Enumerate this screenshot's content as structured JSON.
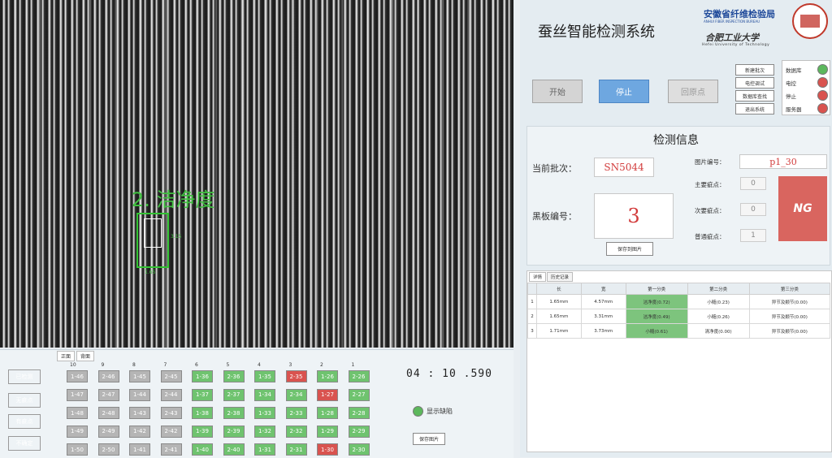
{
  "app": {
    "title": "蚕丝智能检测系统",
    "org1": "安徽省纤维检验局",
    "org1_sub": "ANHUI FIBER INSPECTION BUREAU",
    "org2": "合肥工业大学",
    "org2_sub": "Hefei University of Technology"
  },
  "camera": {
    "overlay_label": "2. 洁净度",
    "tag_right": "3.15",
    "tag_bottom": "1.65"
  },
  "controls": {
    "start": "开始",
    "stop": "停止",
    "home": "回原点",
    "small_buttons": [
      "新建批次",
      "电控调试",
      "数据库查找",
      "退出系统"
    ]
  },
  "status": [
    {
      "label": "数据库",
      "color": "#5cb85c"
    },
    {
      "label": "电控",
      "color": "#d9534f"
    },
    {
      "label": "停止",
      "color": "#d9534f"
    },
    {
      "label": "服务器",
      "color": "#d9534f"
    }
  ],
  "info": {
    "title": "检测信息",
    "batch_label": "当前批次：",
    "batch_value": "SN5044",
    "board_label": "黑板编号：",
    "board_value": "3",
    "pic_label": "图片编号：",
    "pic_value": "p1_30",
    "major_label": "主要疵点：",
    "major_value": "0",
    "minor_label": "次要疵点：",
    "minor_value": "0",
    "general_label": "普通疵点：",
    "general_value": "1",
    "result": "NG",
    "switch_btn": "保存到图片"
  },
  "results_table": {
    "tabs": [
      "详情",
      "历史记录"
    ],
    "headers": [
      "",
      "长",
      "宽",
      "第一分类",
      "第二分类",
      "第三分类"
    ],
    "rows": [
      [
        "1",
        "1.65mm",
        "4.57mm",
        "洁净度(0.72)",
        "小糙(0.23)",
        "异节及颣节(0.00)"
      ],
      [
        "2",
        "1.65mm",
        "3.31mm",
        "洁净度(0.49)",
        "小糙(0.26)",
        "异节及颣节(0.00)"
      ],
      [
        "3",
        "1.71mm",
        "3.73mm",
        "小糙(0.61)",
        "清净度(0.00)",
        "异节及颣节(0.00)"
      ]
    ]
  },
  "legend": [
    {
      "label": "已检测",
      "color": "#b5b5b5"
    },
    {
      "label": "无疵点",
      "color": "#6fc36f"
    },
    {
      "label": "有疵点",
      "color": "#d9534f"
    },
    {
      "label": "不确定",
      "color": "#4a90d9"
    }
  ],
  "grid": {
    "tabs": [
      "正面",
      "背面"
    ],
    "columns": [
      "10",
      "9",
      "8",
      "7",
      "6",
      "5",
      "4",
      "3",
      "2",
      "1"
    ],
    "rows": [
      [
        {
          "t": "1-46",
          "s": "gray"
        },
        {
          "t": "2-46",
          "s": "gray"
        },
        {
          "t": "1-45",
          "s": "gray"
        },
        {
          "t": "2-45",
          "s": "gray"
        },
        {
          "t": "1-36",
          "s": "green"
        },
        {
          "t": "2-36",
          "s": "green"
        },
        {
          "t": "1-35",
          "s": "green"
        },
        {
          "t": "2-35",
          "s": "red"
        },
        {
          "t": "1-26",
          "s": "green"
        },
        {
          "t": "2-26",
          "s": "green"
        }
      ],
      [
        {
          "t": "1-47",
          "s": "gray"
        },
        {
          "t": "2-47",
          "s": "gray"
        },
        {
          "t": "1-44",
          "s": "gray"
        },
        {
          "t": "2-44",
          "s": "gray"
        },
        {
          "t": "1-37",
          "s": "green"
        },
        {
          "t": "2-37",
          "s": "green"
        },
        {
          "t": "1-34",
          "s": "green"
        },
        {
          "t": "2-34",
          "s": "green"
        },
        {
          "t": "1-27",
          "s": "red"
        },
        {
          "t": "2-27",
          "s": "green"
        }
      ],
      [
        {
          "t": "1-48",
          "s": "gray"
        },
        {
          "t": "2-48",
          "s": "gray"
        },
        {
          "t": "1-43",
          "s": "gray"
        },
        {
          "t": "2-43",
          "s": "gray"
        },
        {
          "t": "1-38",
          "s": "green"
        },
        {
          "t": "2-38",
          "s": "green"
        },
        {
          "t": "1-33",
          "s": "green"
        },
        {
          "t": "2-33",
          "s": "green"
        },
        {
          "t": "1-28",
          "s": "green"
        },
        {
          "t": "2-28",
          "s": "green"
        }
      ],
      [
        {
          "t": "1-49",
          "s": "gray"
        },
        {
          "t": "2-49",
          "s": "gray"
        },
        {
          "t": "1-42",
          "s": "gray"
        },
        {
          "t": "2-42",
          "s": "gray"
        },
        {
          "t": "1-39",
          "s": "green"
        },
        {
          "t": "2-39",
          "s": "green"
        },
        {
          "t": "1-32",
          "s": "green"
        },
        {
          "t": "2-32",
          "s": "green"
        },
        {
          "t": "1-29",
          "s": "green"
        },
        {
          "t": "2-29",
          "s": "green"
        }
      ],
      [
        {
          "t": "1-50",
          "s": "gray"
        },
        {
          "t": "2-50",
          "s": "gray"
        },
        {
          "t": "1-41",
          "s": "gray"
        },
        {
          "t": "2-41",
          "s": "gray"
        },
        {
          "t": "1-40",
          "s": "green"
        },
        {
          "t": "2-40",
          "s": "green"
        },
        {
          "t": "1-31",
          "s": "green"
        },
        {
          "t": "2-31",
          "s": "green"
        },
        {
          "t": "1-30",
          "s": "red"
        },
        {
          "t": "2-30",
          "s": "green"
        }
      ]
    ]
  },
  "timer": "04 : 10 .590",
  "show_defect": "显示缺陷",
  "save_image": "保存图片"
}
